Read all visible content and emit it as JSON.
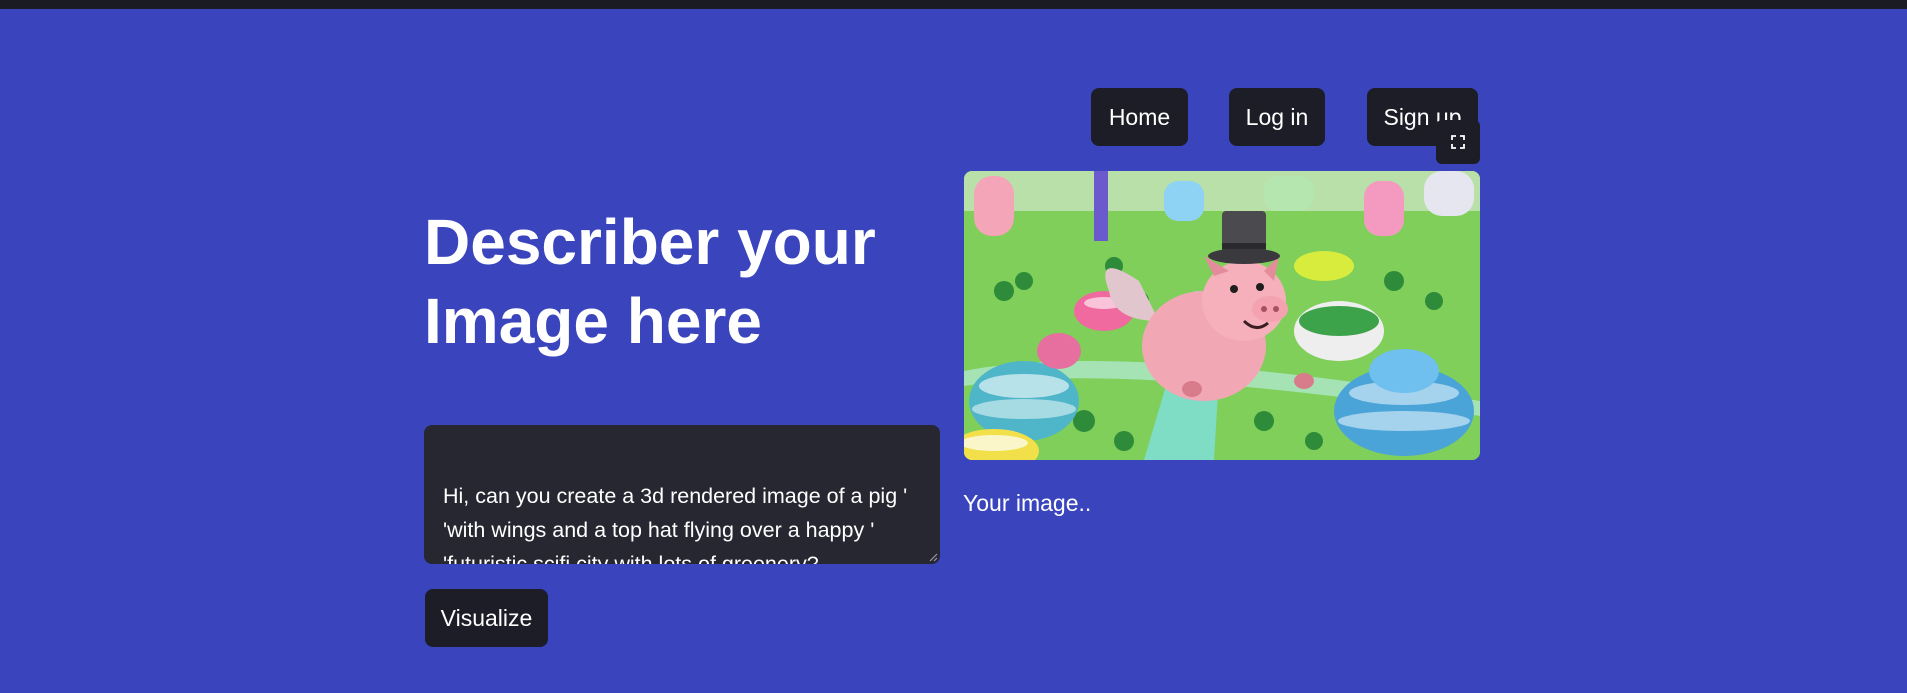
{
  "nav": {
    "home_label": "Home",
    "login_label": "Log in",
    "signup_label": "Sign up"
  },
  "hero": {
    "title": "Describer your Image here"
  },
  "prompt": {
    "value": "Hi, can you create a 3d rendered image of a pig '\n'with wings and a top hat flying over a happy '\n'futuristic scifi city with lots of greenery?"
  },
  "actions": {
    "visualize_label": "Visualize"
  },
  "output": {
    "caption": "Your image..",
    "image_icon": "flying-pig-image",
    "fullscreen_icon": "expand-icon"
  },
  "colors": {
    "background": "#3a44bd",
    "button_bg": "#1c1d26",
    "input_bg": "#262730",
    "text": "#ffffff"
  }
}
